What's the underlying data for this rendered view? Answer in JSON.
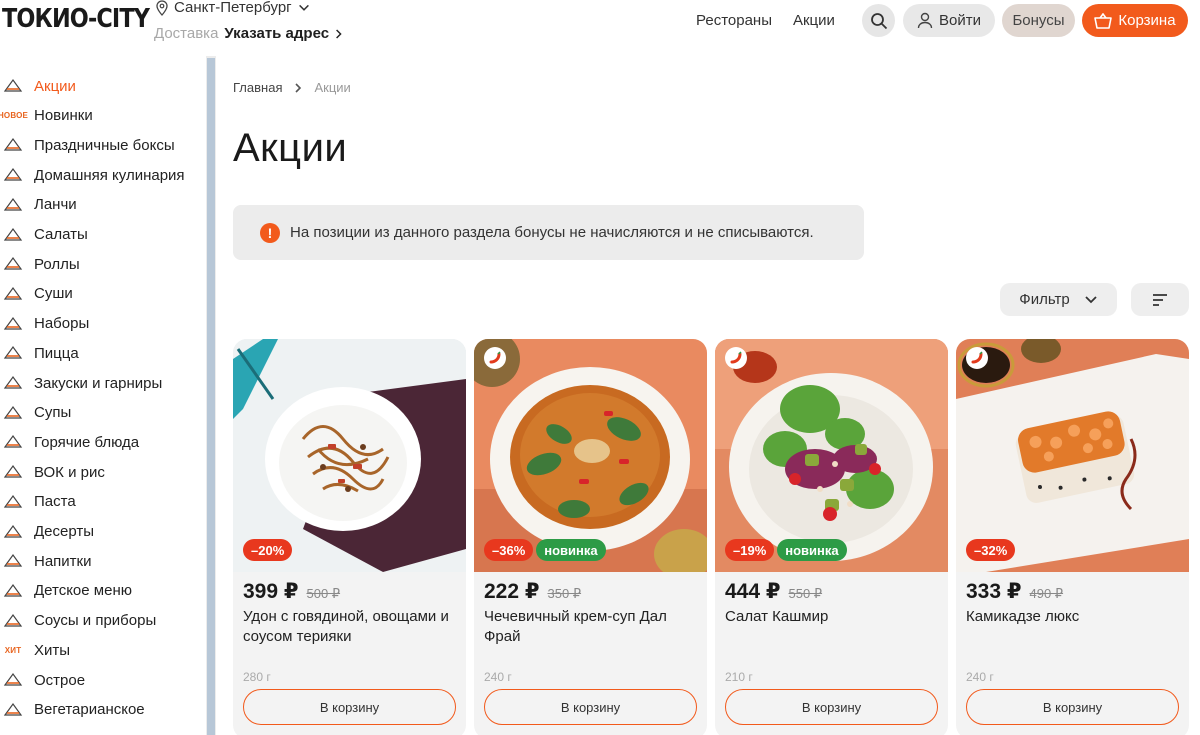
{
  "header": {
    "logo": "ТОКИО-CITY",
    "city": "Санкт-Петербург",
    "delivery_label": "Доставка",
    "delivery_link": "Указать адрес",
    "nav": [
      "Рестораны",
      "Акции"
    ],
    "login_label": "Войти",
    "bonus_label": "Бонусы",
    "cart_label": "Корзина"
  },
  "sidebar": {
    "items": [
      {
        "label": "Акции",
        "icon": "discount-tag-icon",
        "active": true
      },
      {
        "label": "Новинки",
        "icon": "new-badge-icon",
        "icon_text": "НОВОЕ"
      },
      {
        "label": "Праздничные боксы",
        "icon": "gift-box-icon"
      },
      {
        "label": "Домашняя кулинария",
        "icon": "jars-icon"
      },
      {
        "label": "Ланчи",
        "icon": "lunch-icon"
      },
      {
        "label": "Салаты",
        "icon": "salad-icon"
      },
      {
        "label": "Роллы",
        "icon": "roll-icon"
      },
      {
        "label": "Суши",
        "icon": "sushi-icon"
      },
      {
        "label": "Наборы",
        "icon": "set-icon"
      },
      {
        "label": "Пицца",
        "icon": "pizza-icon"
      },
      {
        "label": "Закуски и гарниры",
        "icon": "snacks-icon"
      },
      {
        "label": "Супы",
        "icon": "soup-icon"
      },
      {
        "label": "Горячие блюда",
        "icon": "hot-dish-icon"
      },
      {
        "label": "ВОК и рис",
        "icon": "wok-icon"
      },
      {
        "label": "Паста",
        "icon": "pasta-icon"
      },
      {
        "label": "Десерты",
        "icon": "dessert-icon"
      },
      {
        "label": "Напитки",
        "icon": "drink-icon"
      },
      {
        "label": "Детское меню",
        "icon": "kids-icon"
      },
      {
        "label": "Соусы и приборы",
        "icon": "sauce-icon"
      },
      {
        "label": "Хиты",
        "icon": "hits-icon",
        "icon_text": "ХИТ"
      },
      {
        "label": "Острое",
        "icon": "spicy-icon"
      },
      {
        "label": "Вегетарианское",
        "icon": "vegetarian-icon"
      }
    ]
  },
  "breadcrumb": {
    "home": "Главная",
    "current": "Акции"
  },
  "page_title": "Акции",
  "notice": {
    "icon_text": "!",
    "text": "На позиции из данного раздела бонусы не начисляются и не списываются."
  },
  "filter_label": "Фильтр",
  "products": [
    {
      "discount": "–20%",
      "is_new": false,
      "new_label": "",
      "price": "399 ₽",
      "old_price": "500 ₽",
      "name": "Удон с говядиной, овощами и соусом терияки",
      "weight": "280 г",
      "button": "В корзину",
      "spicy": false
    },
    {
      "discount": "–36%",
      "is_new": true,
      "new_label": "новинка",
      "price": "222 ₽",
      "old_price": "350 ₽",
      "name": "Чечевичный крем-суп Дал Фрай",
      "weight": "240 г",
      "button": "В корзину",
      "spicy": true
    },
    {
      "discount": "–19%",
      "is_new": true,
      "new_label": "новинка",
      "price": "444 ₽",
      "old_price": "550 ₽",
      "name": "Салат Кашмир",
      "weight": "210 г",
      "button": "В корзину",
      "spicy": true
    },
    {
      "discount": "–32%",
      "is_new": false,
      "new_label": "",
      "price": "333 ₽",
      "old_price": "490 ₽",
      "name": "Камикадзе люкс",
      "weight": "240 г",
      "button": "В корзину",
      "spicy": true
    }
  ],
  "colors": {
    "accent": "#f25a1c",
    "discount": "#e8381e",
    "new": "#2d9b46"
  }
}
